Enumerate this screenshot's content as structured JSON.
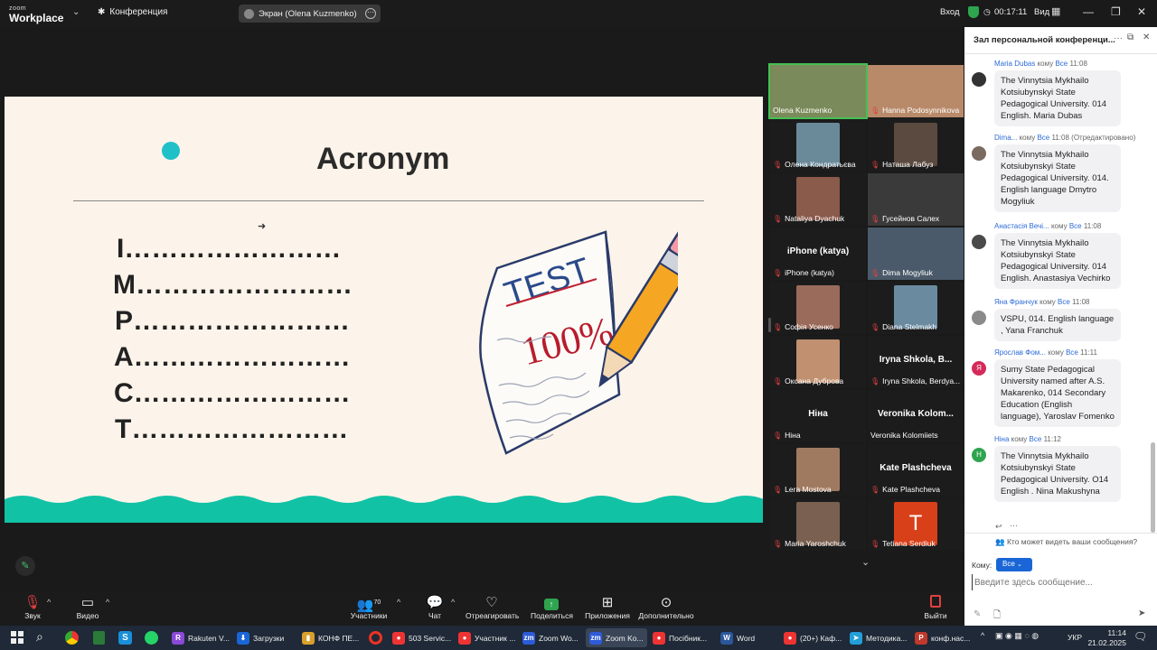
{
  "app": {
    "logo_small": "zoom",
    "logo_big": "Workplace",
    "conference_menu": "Конференция",
    "screen_share_label": "Экран (Olena Kuzmenko)",
    "signin": "Вход",
    "timer": "00:17:11",
    "view": "Вид"
  },
  "slide": {
    "title": "Acronym",
    "lines": [
      "I……………………",
      "M……………………",
      "P……………………",
      "A……………………",
      "C……………………",
      "T……………………"
    ],
    "test_word": "TEST",
    "score": "100%",
    "colors": {
      "accent": "#20c0c8",
      "background": "#fcf4ea"
    }
  },
  "gallery": {
    "participants": [
      {
        "name": "Olena Kuzmenko",
        "muted": false,
        "video": true
      },
      {
        "name": "Hanna Podosynnikova",
        "muted": true,
        "video": true
      },
      {
        "name": "Олена  Кондратьєва",
        "muted": true,
        "video": true
      },
      {
        "name": "Наташа Лабуз",
        "muted": true,
        "video": true
      },
      {
        "name": "Nataliya Dyachuk",
        "muted": true,
        "video": true
      },
      {
        "name": "Гусейнов Салех",
        "muted": true,
        "video": true
      },
      {
        "name": "iPhone (katya)",
        "muted": true,
        "video": false,
        "big": "iPhone (katya)"
      },
      {
        "name": "Dima Mogyliuk",
        "muted": true,
        "video": true
      },
      {
        "name": "Софія Усенко",
        "muted": true,
        "video": true
      },
      {
        "name": "Diana Stelmakh",
        "muted": true,
        "video": true
      },
      {
        "name": "Оксана Дуброва",
        "muted": true,
        "video": true
      },
      {
        "name": "Iryna Shkola,  Berdya...",
        "muted": true,
        "video": false,
        "big": "Iryna Shkola,   B..."
      },
      {
        "name": "Ніна",
        "muted": true,
        "video": false,
        "big": "Ніна"
      },
      {
        "name": "Veronika Kolomiiets",
        "muted": false,
        "video": false,
        "big": "Veronika  Kolom..."
      },
      {
        "name": "Lera Mostova",
        "muted": true,
        "video": true
      },
      {
        "name": "Kate Plashcheva",
        "muted": true,
        "video": false,
        "big": "Kate Plashcheva"
      },
      {
        "name": "Maria Yaroshchuk",
        "muted": true,
        "video": true
      },
      {
        "name": "Tetiana Serdiuk",
        "muted": true,
        "video": false,
        "avatar_letter": "T"
      }
    ]
  },
  "chat": {
    "title": "Зал персональной конференци...",
    "messages": [
      {
        "sender": "Maria Dubas",
        "to_word": "кому",
        "to": "Все",
        "time": "11:08",
        "edited": "",
        "text": "The Vinnytsia Mykhailo Kotsiubynskyi State Pedagogical University. 014 English. Maria Dubas",
        "avatar_color": "#333"
      },
      {
        "sender": "Dima...",
        "to_word": "кому",
        "to": "Все",
        "time": "11:08",
        "edited": "(Отредактировано)",
        "text": "The Vinnytsia Mykhailo Kotsiubynskyi State Pedagogical University. 014. English language Dmytro Mogyliuk",
        "avatar_color": "#7a6a60"
      },
      {
        "sender": "Анастасія Вечі...",
        "to_word": "кому",
        "to": "Все",
        "time": "11:08",
        "edited": "",
        "text": "The Vinnytsia Mykhailo Kotsiubynskyi State Pedagogical University. 014 English. Anastasiya Vechirko",
        "avatar_color": "#4a4a4a"
      },
      {
        "sender": "Яна Франчук",
        "to_word": "кому",
        "to": "Все",
        "time": "11:08",
        "edited": "",
        "text": "VSPU, 014. English language , Yana Franchuk",
        "avatar_color": "#8a8a8a"
      },
      {
        "sender": "Ярослав Фом...",
        "to_word": "кому",
        "to": "Все",
        "time": "11:11",
        "edited": "",
        "text": "Sumy State Pedagogical University named after A.S. Makarenko, 014 Secondary Education (English language), Yaroslav Fomenko",
        "avatar_color": "#d42a5a",
        "avatar_letter": "Я"
      },
      {
        "sender": "Ніна",
        "to_word": "кому",
        "to": "Все",
        "time": "11:12",
        "edited": "",
        "text": "The Vinnytsia Mykhailo Kotsiubynskyi State Pedagogical University. O14 English . Nina Makushyna",
        "avatar_color": "#2ea44f",
        "avatar_letter": "Н"
      }
    ],
    "who_can_see": "Кто может видеть ваши сообщения?",
    "to_label": "Кому:",
    "to_value": "Все",
    "input_placeholder": "Введите здесь сообщение..."
  },
  "toolbar": {
    "audio": "Звук",
    "video": "Видео",
    "participants": "Участники",
    "participants_count": "70",
    "chat": "Чат",
    "react": "Отреагировать",
    "share": "Поделиться",
    "apps": "Приложения",
    "more": "Дополнительно",
    "leave": "Выйти"
  },
  "taskbar": {
    "items": [
      "Rakuten V...",
      "Загрузки",
      "КОНФ ПЕ...",
      "503 Servic...",
      "Участник ...",
      "Zoom Wo...",
      "Zoom Ko...",
      "Посібник...",
      "Word",
      "(20+) Каф...",
      "Методика...",
      "конф.нас..."
    ],
    "lang": "УКР",
    "time": "11:14",
    "date": "21.02.2025"
  }
}
